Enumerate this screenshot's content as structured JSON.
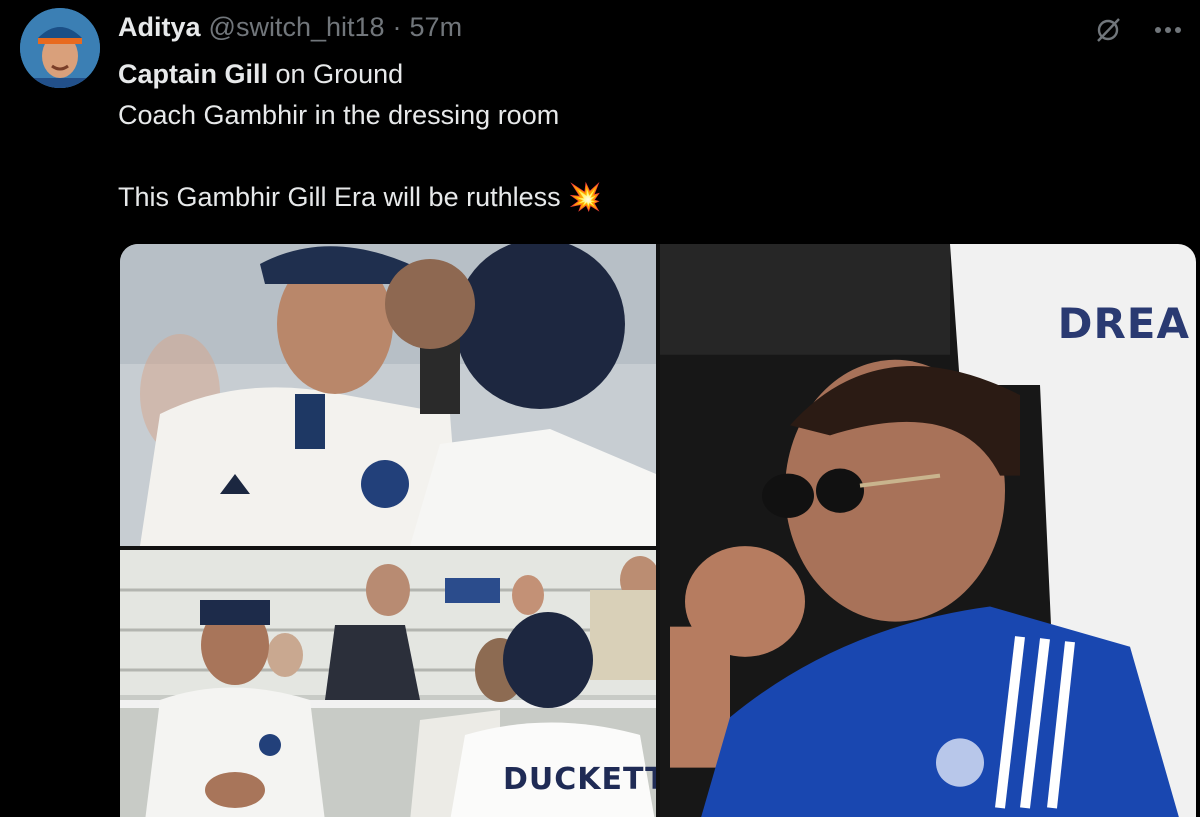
{
  "tweet": {
    "display_name": "Aditya",
    "handle": "@switch_hit18",
    "separator": "·",
    "time": "57m",
    "line1_bold": "Captain Gill",
    "line1_rest": " on Ground",
    "line2": "Coach Gambhir in the dressing room",
    "line3": "This Gambhir Gill Era will be ruthless",
    "emoji": "💥"
  },
  "media": {
    "jersey_text_right": "DREA",
    "jersey_text_bottom": "DUCKETT"
  },
  "icons": {
    "grok": "grok-icon",
    "more": "more-icon"
  },
  "colors": {
    "background": "#000000",
    "text": "#e7e9ea",
    "secondary": "#71767b"
  }
}
